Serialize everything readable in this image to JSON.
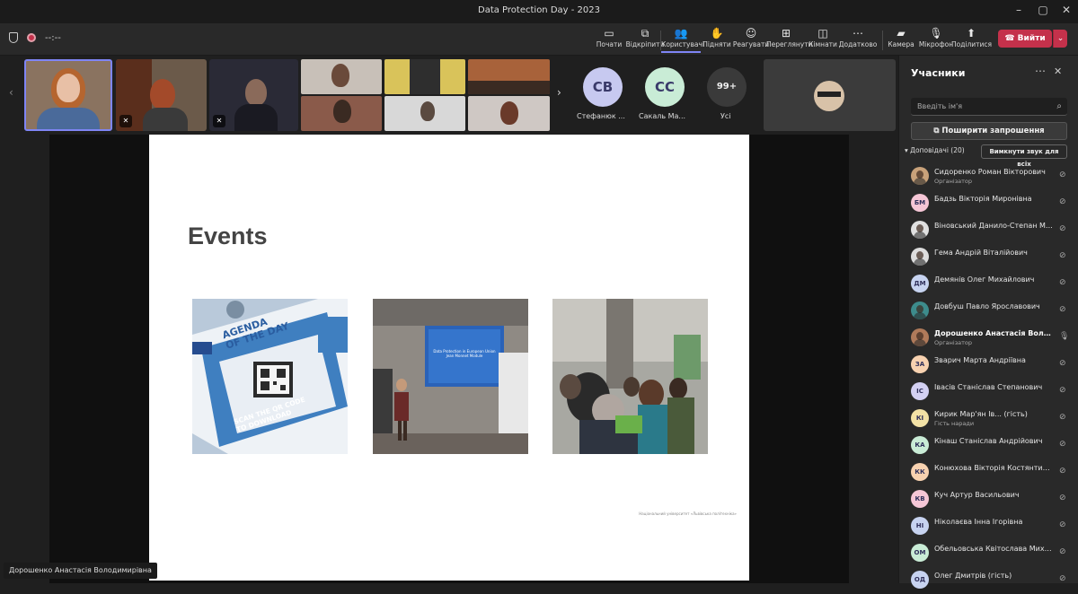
{
  "window": {
    "title": "Data Protection Day - 2023"
  },
  "toolbar": {
    "timer": "--:--",
    "buttons": [
      {
        "label": "Почати",
        "icon": "▭"
      },
      {
        "label": "Відкріпити",
        "icon": "⧉"
      },
      {
        "label": "Користувачі",
        "icon": "👥"
      },
      {
        "label": "Підняти",
        "icon": "✋"
      },
      {
        "label": "Реагувати",
        "icon": "☺"
      },
      {
        "label": "Переглянути",
        "icon": "⊞"
      },
      {
        "label": "Кімнати",
        "icon": "◫"
      },
      {
        "label": "Додатково",
        "icon": "⋯"
      },
      {
        "label": "Камера",
        "icon": "▰"
      },
      {
        "label": "Мікрофон",
        "icon": "🎙"
      },
      {
        "label": "Поділитися",
        "icon": "⬆"
      }
    ],
    "leave_label": "Вийти"
  },
  "strip": {
    "avatars": [
      {
        "initials": "СВ",
        "name": "Стефанюк ...",
        "color": "#c7c9f0"
      },
      {
        "initials": "СС",
        "name": "Сакаль Ма...",
        "color": "#c9ecd6"
      }
    ],
    "overflow": {
      "count": "99+",
      "label": "Усі"
    }
  },
  "slide": {
    "title": "Events",
    "photos": [
      {
        "alt": "agenda-badge-photo",
        "text1": "AGENDA",
        "text2": "OF THE DAY",
        "text3": "SCAN THE QR CODE",
        "text4": "TO DOWNLOAD"
      },
      {
        "alt": "presentation-photo",
        "screen_line1": "Data Protection in European Union",
        "screen_line2": "Jean Monnet Module"
      },
      {
        "alt": "audience-photo"
      }
    ],
    "footer": "Національний університет «Львівська політехніка»"
  },
  "presenter": {
    "name": "Дорошенко Анастасія Володимирівна"
  },
  "panel": {
    "title": "Учасники",
    "search_placeholder": "Введіть ім'я",
    "share_label": "Поширити запрошення",
    "group_label": "Доповідачі (20)",
    "mute_all_label": "Вимкнути звук для всіх",
    "participants": [
      {
        "name": "Сидоренко Роман Вікторович",
        "role": "Організатор",
        "initials": "",
        "color": "#c9a27a",
        "photo": true
      },
      {
        "name": "Бадзь Вікторія Миронівна",
        "role": "",
        "initials": "БМ",
        "color": "#f5c6d6"
      },
      {
        "name": "Віновський Данило-Степан Ми...",
        "role": "",
        "initials": "",
        "color": "#e0e0e0",
        "photo": true
      },
      {
        "name": "Гема Андрій Віталійович",
        "role": "",
        "initials": "",
        "color": "#dddddd",
        "photo": true
      },
      {
        "name": "Демянів Олег Михайлович",
        "role": "",
        "initials": "ДМ",
        "color": "#c7d3f0"
      },
      {
        "name": "Довбуш Павло Ярославович",
        "role": "",
        "initials": "",
        "color": "#3d8c8c",
        "photo": true
      },
      {
        "name": "Дорошенко Анастасія Володи...",
        "role": "Організатор",
        "initials": "",
        "color": "#b07a5a",
        "photo": true,
        "bold": true
      },
      {
        "name": "Зварич Марта Андріївна",
        "role": "",
        "initials": "ЗА",
        "color": "#f8d2b0"
      },
      {
        "name": "Івасів Станіслав Степанович",
        "role": "",
        "initials": "ІС",
        "color": "#d3d0f2"
      },
      {
        "name": "Кирик Мар'ян Ів... (гість)",
        "role": "Гість наради",
        "initials": "КІ",
        "color": "#f3e2a6"
      },
      {
        "name": "Кінаш Станіслав Андрійович",
        "role": "",
        "initials": "КА",
        "color": "#c9ecd6"
      },
      {
        "name": "Конюхова Вікторія Костянтинів...",
        "role": "",
        "initials": "КК",
        "color": "#f8d2b0"
      },
      {
        "name": "Куч Артур Васильович",
        "role": "",
        "initials": "КВ",
        "color": "#f5c6d6"
      },
      {
        "name": "Ніколаєва Інна Ігорівна",
        "role": "",
        "initials": "НІ",
        "color": "#c7d3f0"
      },
      {
        "name": "Обельовська Квітослава Михай...",
        "role": "",
        "initials": "ОМ",
        "color": "#c9ecd6"
      },
      {
        "name": "Олег Дмитрів (гість)",
        "role": "",
        "initials": "ОД",
        "color": "#c7d3f0"
      }
    ]
  }
}
